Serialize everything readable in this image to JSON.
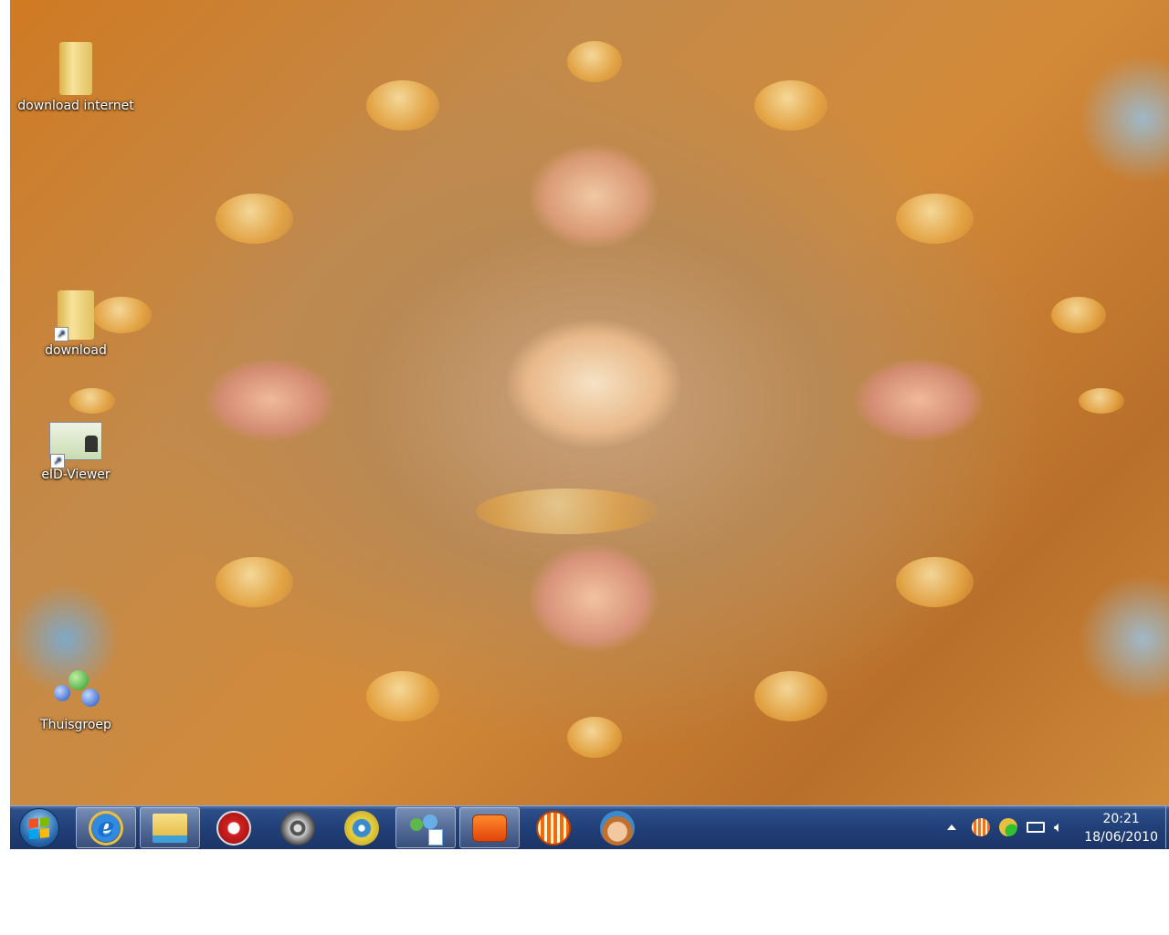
{
  "desktop": {
    "icons": [
      {
        "label": "download internet",
        "icon": "folder-icon"
      },
      {
        "label": "download",
        "icon": "folder-shortcut-icon"
      },
      {
        "label": "eID-Viewer",
        "icon": "eid-card-shortcut-icon"
      },
      {
        "label": "Thuisgroep",
        "icon": "homegroup-icon"
      }
    ]
  },
  "taskbar": {
    "buttons": [
      {
        "name": "internet-explorer",
        "icon": "ie-icon",
        "active": true
      },
      {
        "name": "windows-explorer",
        "icon": "folder-icon",
        "active": true
      },
      {
        "name": "nero",
        "icon": "flame-icon",
        "active": false
      },
      {
        "name": "video-editor",
        "icon": "film-reel-icon",
        "active": false
      },
      {
        "name": "media-sync",
        "icon": "disc-sync-icon",
        "active": false
      },
      {
        "name": "messenger",
        "icon": "messenger-icon",
        "active": true
      },
      {
        "name": "mail",
        "icon": "envelope-icon",
        "active": true
      },
      {
        "name": "orange-app",
        "icon": "orange-globe-icon",
        "active": false
      },
      {
        "name": "monkey-app",
        "icon": "monkey-icon",
        "active": false
      }
    ],
    "clock": {
      "time": "20:21",
      "date": "18/06/2010"
    }
  }
}
